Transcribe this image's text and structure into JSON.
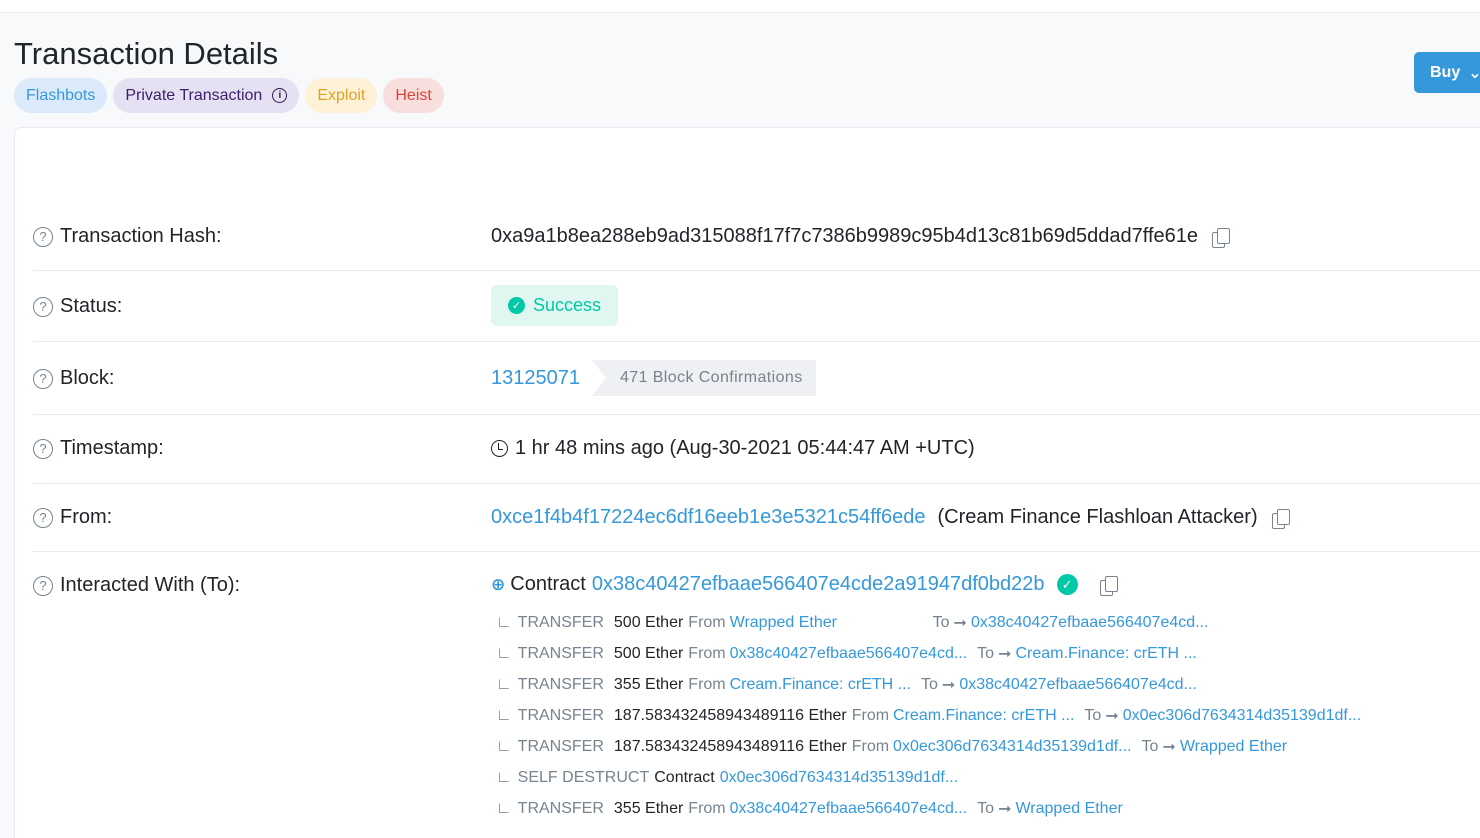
{
  "page": {
    "title": "Transaction Details",
    "buy_label": "Buy"
  },
  "tags": [
    {
      "label": "Flashbots"
    },
    {
      "label": "Private Transaction"
    },
    {
      "label": "Exploit"
    },
    {
      "label": "Heist"
    }
  ],
  "fields": {
    "hash": {
      "label": "Transaction Hash:",
      "value": "0xa9a1b8ea288eb9ad315088f17f7c7386b9989c95b4d13c81b69d5ddad7ffe61e"
    },
    "status": {
      "label": "Status:",
      "value": "Success"
    },
    "block": {
      "label": "Block:",
      "value": "13125071",
      "confirmations": "471 Block Confirmations"
    },
    "timestamp": {
      "label": "Timestamp:",
      "value": "1 hr 48 mins ago (Aug-30-2021 05:44:47 AM +UTC)"
    },
    "from": {
      "label": "From:",
      "address": "0xce1f4b4f17224ec6df16eeb1e3e5321c54ff6ede",
      "name": "(Cream Finance Flashloan Attacker)"
    },
    "to": {
      "label": "Interacted With (To):",
      "prefix": "Contract",
      "address": "0x38c40427efbaae566407e4cde2a91947df0bd22b"
    }
  },
  "transfers": [
    {
      "kind": "TRANSFER",
      "amount": "500 Ether",
      "from_label": "From",
      "from": "Wrapped Ether",
      "to_label": "To",
      "to": "0x38c40427efbaae566407e4cd..."
    },
    {
      "kind": "TRANSFER",
      "amount": "500 Ether",
      "from_label": "From",
      "from": "0x38c40427efbaae566407e4cd...",
      "to_label": "To",
      "to": "Cream.Finance: crETH ..."
    },
    {
      "kind": "TRANSFER",
      "amount": "355 Ether",
      "from_label": "From",
      "from": "Cream.Finance: crETH ...",
      "to_label": "To",
      "to": "0x38c40427efbaae566407e4cd..."
    },
    {
      "kind": "TRANSFER",
      "amount": "187.583432458943489116 Ether",
      "from_label": "From",
      "from": "Cream.Finance: crETH ...",
      "to_label": "To",
      "to": "0x0ec306d7634314d35139d1df..."
    },
    {
      "kind": "TRANSFER",
      "amount": "187.583432458943489116 Ether",
      "from_label": "From",
      "from": "0x0ec306d7634314d35139d1df...",
      "to_label": "To",
      "to": "Wrapped Ether"
    },
    {
      "kind": "SELF DESTRUCT",
      "amount": "Contract",
      "from_label": "",
      "from": "0x0ec306d7634314d35139d1df...",
      "to_label": "",
      "to": ""
    },
    {
      "kind": "TRANSFER",
      "amount": "355 Ether",
      "from_label": "From",
      "from": "0x38c40427efbaae566407e4cd...",
      "to_label": "To",
      "to": "Wrapped Ether"
    }
  ],
  "colors": {
    "link": "#3498db",
    "success": "#00c9a7",
    "muted": "#77838f"
  }
}
